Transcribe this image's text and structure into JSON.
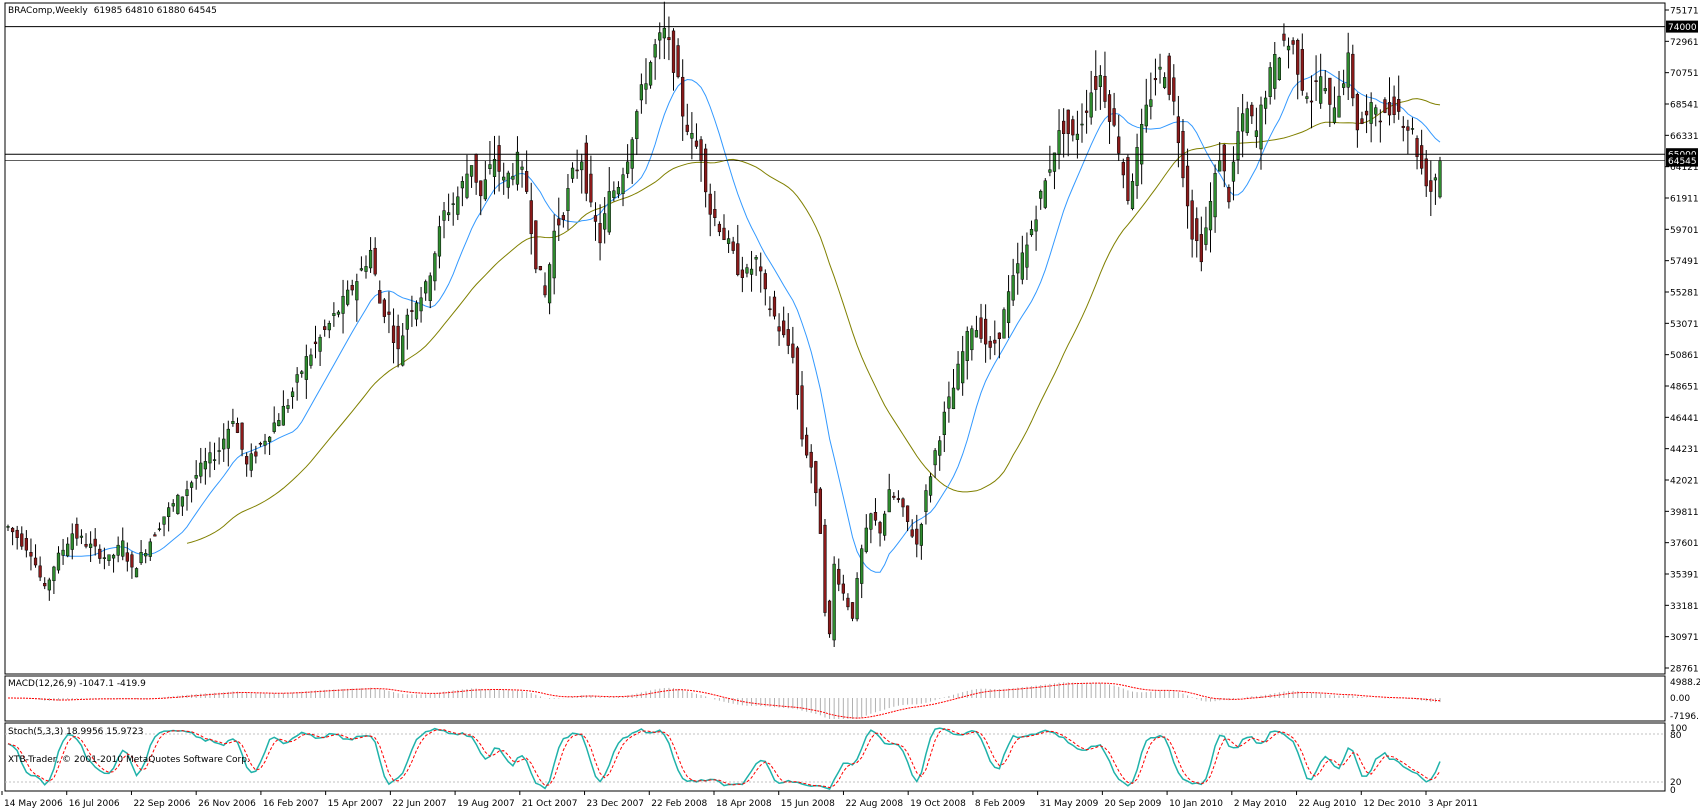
{
  "chart_data": {
    "type": "candlestick",
    "title": "BRAComp,Weekly",
    "ohlc_header": "61985 64810 61880 64545",
    "colors": {
      "up": "#2e8b2e",
      "down": "#8b1a1a",
      "wick": "#000000",
      "ma_fast": "#3399ff",
      "ma_slow": "#808000",
      "macd_hist": "#b0b0b0",
      "macd_signal": "#ff0000",
      "stoch_main": "#20b2aa",
      "stoch_signal": "#ff0000",
      "level_lines": "#000000",
      "current_line": "#000000"
    },
    "price_axis": {
      "ylim": [
        28761,
        75171
      ],
      "tick_labels": [
        "75171",
        "72961",
        "70751",
        "68541",
        "66331",
        "64121",
        "61911",
        "59701",
        "57491",
        "55281",
        "53071",
        "50861",
        "48651",
        "46441",
        "44231",
        "42021",
        "39811",
        "37601",
        "35391",
        "33181",
        "30971",
        "28761"
      ]
    },
    "levels": [
      {
        "value": 74000,
        "label": "74000"
      },
      {
        "value": 65000,
        "label": "65000"
      }
    ],
    "current_price": {
      "value": 64545,
      "label": "64545"
    },
    "x_axis": {
      "tick_labels": [
        "14 May 2006",
        "16 Jul 2006",
        "22 Sep 2006",
        "26 Nov 2006",
        "16 Feb 2007",
        "15 Apr 2007",
        "22 Jun 2007",
        "19 Aug 2007",
        "21 Oct 2007",
        "23 Dec 2007",
        "22 Feb 2008",
        "18 Apr 2008",
        "15 Jun 2008",
        "22 Aug 2008",
        "19 Oct 2008",
        "8 Feb 2009",
        "31 May 2009",
        "20 Sep 2009",
        "10 Jan 2010",
        "2 May 2010",
        "22 Aug 2010",
        "12 Dec 2010",
        "3 Apr 2011"
      ]
    },
    "close_path": [
      [
        0,
        38700
      ],
      [
        5,
        37000
      ],
      [
        8,
        34200
      ],
      [
        10,
        36000
      ],
      [
        14,
        38300
      ],
      [
        18,
        37300
      ],
      [
        22,
        36400
      ],
      [
        25,
        37500
      ],
      [
        27,
        35600
      ],
      [
        30,
        37200
      ],
      [
        34,
        39500
      ],
      [
        38,
        41000
      ],
      [
        42,
        42800
      ],
      [
        46,
        44200
      ],
      [
        49,
        46500
      ],
      [
        52,
        43000
      ],
      [
        55,
        44500
      ],
      [
        58,
        46000
      ],
      [
        61,
        47500
      ],
      [
        65,
        50500
      ],
      [
        68,
        52000
      ],
      [
        71,
        53500
      ],
      [
        74,
        55000
      ],
      [
        77,
        56800
      ],
      [
        79,
        58200
      ],
      [
        81,
        54500
      ],
      [
        83,
        53500
      ],
      [
        85,
        51000
      ],
      [
        87,
        53800
      ],
      [
        89,
        54800
      ],
      [
        91,
        55500
      ],
      [
        93,
        58200
      ],
      [
        95,
        60800
      ],
      [
        98,
        62000
      ],
      [
        101,
        64500
      ],
      [
        103,
        62000
      ],
      [
        106,
        64800
      ],
      [
        108,
        63000
      ],
      [
        111,
        64500
      ],
      [
        113,
        62500
      ],
      [
        115,
        57500
      ],
      [
        117,
        55000
      ],
      [
        119,
        59500
      ],
      [
        121,
        61000
      ],
      [
        123,
        63500
      ],
      [
        125,
        64800
      ],
      [
        127,
        61000
      ],
      [
        129,
        59000
      ],
      [
        131,
        62000
      ],
      [
        133,
        63000
      ],
      [
        135,
        65000
      ],
      [
        137,
        68000
      ],
      [
        139,
        70500
      ],
      [
        141,
        72500
      ],
      [
        143,
        73500
      ],
      [
        145,
        71500
      ],
      [
        147,
        68000
      ],
      [
        149,
        66000
      ],
      [
        151,
        65000
      ],
      [
        153,
        61000
      ],
      [
        155,
        60000
      ],
      [
        157,
        58500
      ],
      [
        159,
        57000
      ],
      [
        161,
        56500
      ],
      [
        163,
        57500
      ],
      [
        165,
        55000
      ],
      [
        167,
        53500
      ],
      [
        169,
        52000
      ],
      [
        171,
        51000
      ],
      [
        173,
        45000
      ],
      [
        175,
        43000
      ],
      [
        177,
        38500
      ],
      [
        178,
        33000
      ],
      [
        179,
        31000
      ],
      [
        180,
        36000
      ],
      [
        182,
        34000
      ],
      [
        184,
        32500
      ],
      [
        186,
        37000
      ],
      [
        188,
        39500
      ],
      [
        190,
        38500
      ],
      [
        192,
        41000
      ],
      [
        194,
        40500
      ],
      [
        196,
        39000
      ],
      [
        198,
        37500
      ],
      [
        200,
        41000
      ],
      [
        202,
        44000
      ],
      [
        204,
        46500
      ],
      [
        206,
        48500
      ],
      [
        208,
        51000
      ],
      [
        210,
        53000
      ],
      [
        212,
        52500
      ],
      [
        214,
        51000
      ],
      [
        216,
        52500
      ],
      [
        218,
        55000
      ],
      [
        220,
        57000
      ],
      [
        222,
        58500
      ],
      [
        224,
        61000
      ],
      [
        226,
        63000
      ],
      [
        228,
        65500
      ],
      [
        230,
        67000
      ],
      [
        232,
        66000
      ],
      [
        234,
        67500
      ],
      [
        236,
        69500
      ],
      [
        238,
        70500
      ],
      [
        240,
        68000
      ],
      [
        242,
        65500
      ],
      [
        244,
        62000
      ],
      [
        246,
        65000
      ],
      [
        248,
        68000
      ],
      [
        250,
        70500
      ],
      [
        252,
        71000
      ],
      [
        254,
        68500
      ],
      [
        256,
        64000
      ],
      [
        258,
        59500
      ],
      [
        260,
        58000
      ],
      [
        262,
        61500
      ],
      [
        264,
        65000
      ],
      [
        266,
        62000
      ],
      [
        268,
        66500
      ],
      [
        270,
        68000
      ],
      [
        272,
        66500
      ],
      [
        274,
        69500
      ],
      [
        276,
        71500
      ],
      [
        278,
        73000
      ],
      [
        280,
        72500
      ],
      [
        282,
        70000
      ],
      [
        284,
        69000
      ],
      [
        286,
        70500
      ],
      [
        288,
        68000
      ],
      [
        290,
        69500
      ],
      [
        292,
        71500
      ],
      [
        294,
        67000
      ],
      [
        296,
        67500
      ],
      [
        298,
        68500
      ],
      [
        300,
        67500
      ],
      [
        302,
        68500
      ],
      [
        304,
        67500
      ],
      [
        306,
        66500
      ],
      [
        308,
        64000
      ],
      [
        310,
        62500
      ],
      [
        312,
        64545
      ]
    ],
    "macd": {
      "label": "MACD(12,26,9) -1047.1 -419.9",
      "axis_labels": [
        "4988.2",
        "0.00",
        "-7196.1"
      ]
    },
    "stoch": {
      "label": "Stoch(5,3,3) 18.9956 15.9723",
      "axis_labels": [
        "100",
        "80",
        "20",
        "0"
      ]
    },
    "footer": "XTB-Trader, © 2001-2010 MetaQuotes Software Corp."
  }
}
